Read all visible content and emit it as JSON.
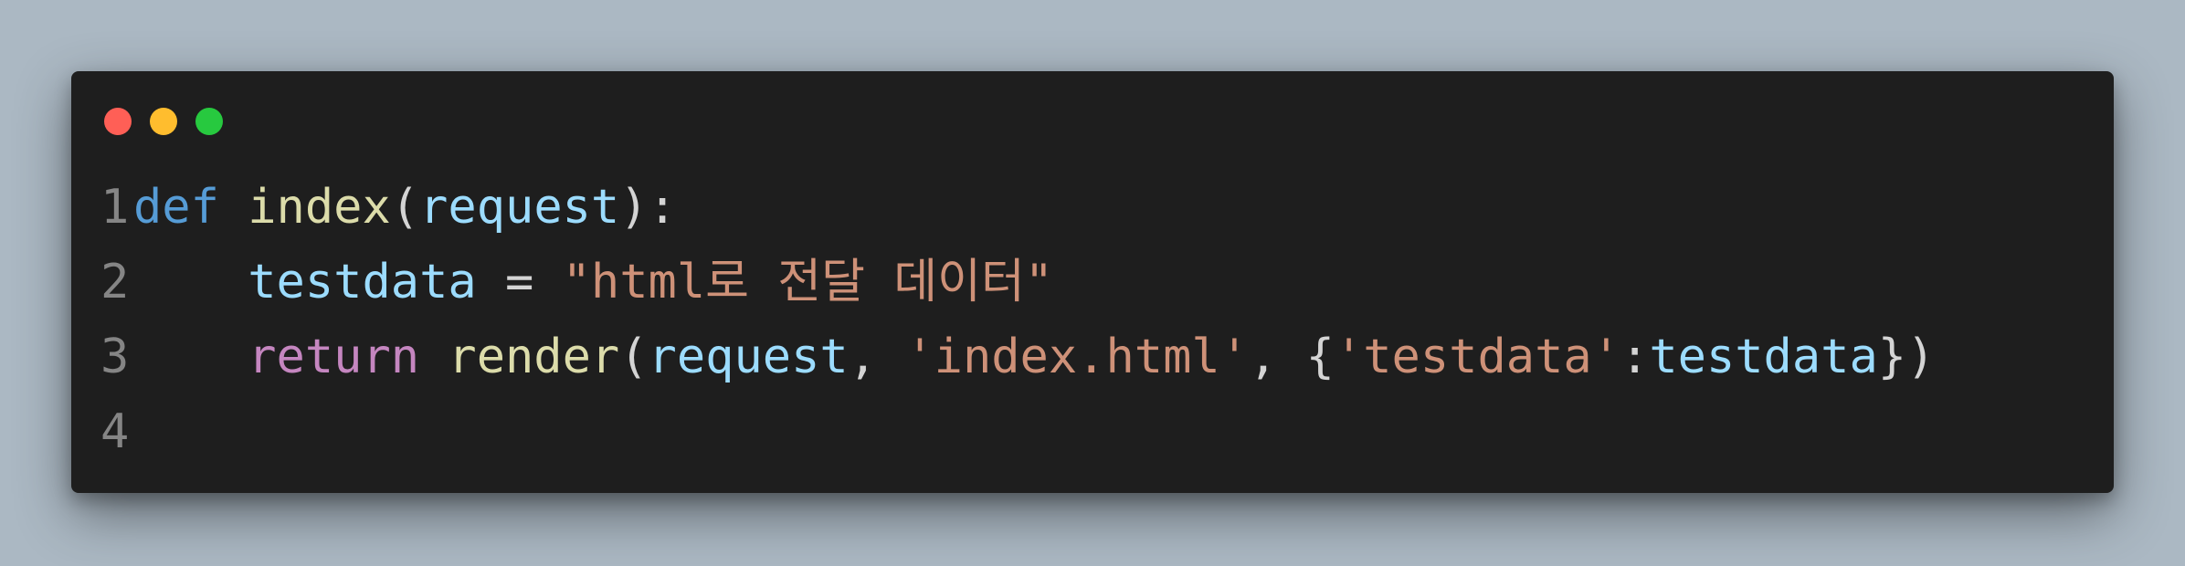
{
  "theme": {
    "background": "#abb8c3",
    "window_bg": "#1e1e1e",
    "line_number": "#858585",
    "dots": [
      "#ff5f56",
      "#ffbd2e",
      "#27c93f"
    ],
    "token_colors": {
      "keyword": "#569cd6",
      "control": "#c586c0",
      "function": "#dcdcaa",
      "variable": "#9cdcfe",
      "string": "#ce9178",
      "punctuation": "#d4d4d4",
      "operator": "#d4d4d4"
    }
  },
  "window": {
    "dots": [
      "close-dot",
      "minimize-dot",
      "maximize-dot"
    ]
  },
  "code": {
    "lines": [
      {
        "number": "1",
        "tokens": [
          {
            "text": "def",
            "type": "keyword"
          },
          {
            "text": " ",
            "type": "ws"
          },
          {
            "text": "index",
            "type": "function"
          },
          {
            "text": "(",
            "type": "punctuation"
          },
          {
            "text": "request",
            "type": "variable"
          },
          {
            "text": "):",
            "type": "punctuation"
          }
        ]
      },
      {
        "number": "2",
        "tokens": [
          {
            "text": "    ",
            "type": "ws"
          },
          {
            "text": "testdata",
            "type": "variable"
          },
          {
            "text": " = ",
            "type": "operator"
          },
          {
            "text": "\"html로 전달 데이터\"",
            "type": "string"
          }
        ]
      },
      {
        "number": "3",
        "tokens": [
          {
            "text": "    ",
            "type": "ws"
          },
          {
            "text": "return",
            "type": "control"
          },
          {
            "text": " ",
            "type": "ws"
          },
          {
            "text": "render",
            "type": "function"
          },
          {
            "text": "(",
            "type": "punctuation"
          },
          {
            "text": "request",
            "type": "variable"
          },
          {
            "text": ", ",
            "type": "punctuation"
          },
          {
            "text": "'index.html'",
            "type": "string"
          },
          {
            "text": ", {",
            "type": "punctuation"
          },
          {
            "text": "'testdata'",
            "type": "string"
          },
          {
            "text": ":",
            "type": "punctuation"
          },
          {
            "text": "testdata",
            "type": "variable"
          },
          {
            "text": "})",
            "type": "punctuation"
          }
        ]
      },
      {
        "number": "4",
        "tokens": []
      }
    ]
  }
}
